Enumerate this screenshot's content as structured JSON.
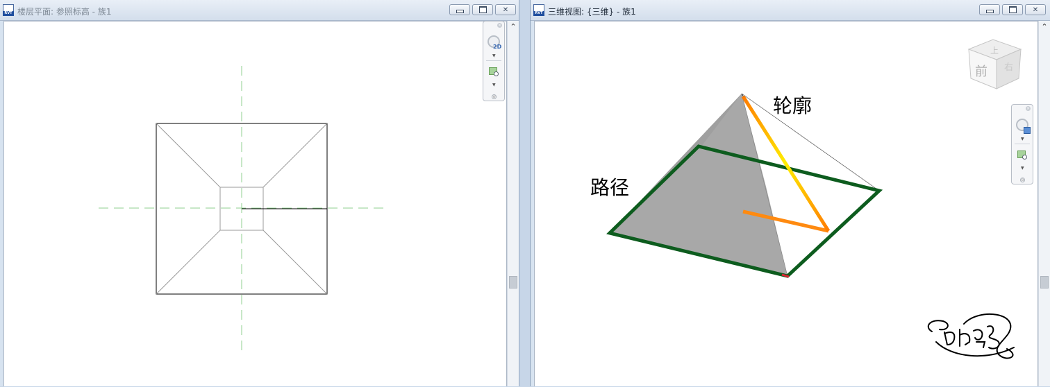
{
  "left_window": {
    "title": "楼层平面: 参照标高 - 族1",
    "app_icon_label": "RVT",
    "nav_wheel_badge": "2D"
  },
  "right_window": {
    "title": "三维视图: {三维} - 族1",
    "app_icon_label": "RVT",
    "viewcube": {
      "top_face": "上",
      "front_face": "前",
      "right_face": "右"
    },
    "labels": {
      "profile": "轮廓",
      "path": "路径"
    }
  },
  "colors": {
    "path_sweep": "#0d5c1e",
    "profile_gradient": [
      "#ff7a00",
      "#ffee00"
    ],
    "solid_face": "#a9a9a9",
    "reference_plane": "#8fcf8f"
  }
}
